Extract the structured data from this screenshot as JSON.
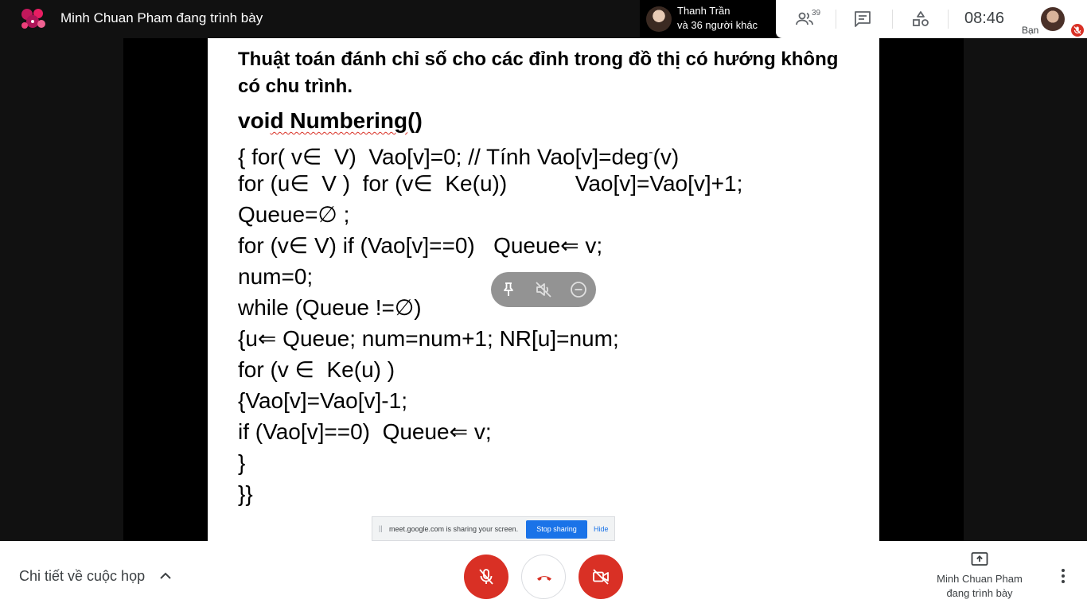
{
  "topbar": {
    "presenter_title": "Minh Chuan Pham đang trình bày",
    "participant_name": "Thanh Trần",
    "participant_others": "và 36 người khác",
    "people_count": "39",
    "clock": "08:46",
    "self_label": "Bạn"
  },
  "slide": {
    "heading_line1": "Thuật toán đánh chỉ số cho các đỉnh trong đồ thị có hướng không",
    "heading_line2": "có chu trình.",
    "func_prefix": "voi",
    "func_name": "d Numbering",
    "func_suffix": "()",
    "lines": [
      "{ for( v∈  V)  Vao[v]=0; // Tính Vao[v]=deg",
      "for (u∈  V )  for (v∈  Ke(u))           Vao[v]=Vao[v]+1;",
      "Queue=∅ ;",
      "for (v∈ V) if (Vao[v]==0)   Queue⇐ v;",
      "num=0;",
      "while (Queue !=∅)",
      "{u⇐ Queue; num=num+1; NR[u]=num;",
      "for (v ∈  Ke(u) )",
      "{Vao[v]=Vao[v]-1;",
      "if (Vao[v]==0)  Queue⇐ v;",
      "}",
      "}}"
    ],
    "deg_superscript": "-",
    "deg_tail": "(v)"
  },
  "share_banner": {
    "grip": "||",
    "message": "meet.google.com is sharing your screen.",
    "stop_label": "Stop sharing",
    "hide_label": "Hide"
  },
  "bottombar": {
    "details_label": "Chi tiết về cuộc họp",
    "present_label_line1": "Minh Chuan Pham",
    "present_label_line2": "đang trình bày"
  },
  "colors": {
    "danger": "#d93025",
    "accent": "#1a73e8",
    "topbar_bg": "#111111"
  },
  "icons": {
    "people": "people-icon",
    "chat": "chat-icon",
    "activities": "activities-icon",
    "mic_off": "mic-off-icon",
    "hang_up": "hang-up-icon",
    "camera_off": "camera-off-icon",
    "present": "present-screen-icon",
    "more": "more-vert-icon",
    "pin": "pin-icon",
    "mute": "mute-icon",
    "remove": "remove-icon",
    "chevron_up": "chevron-up-icon"
  }
}
